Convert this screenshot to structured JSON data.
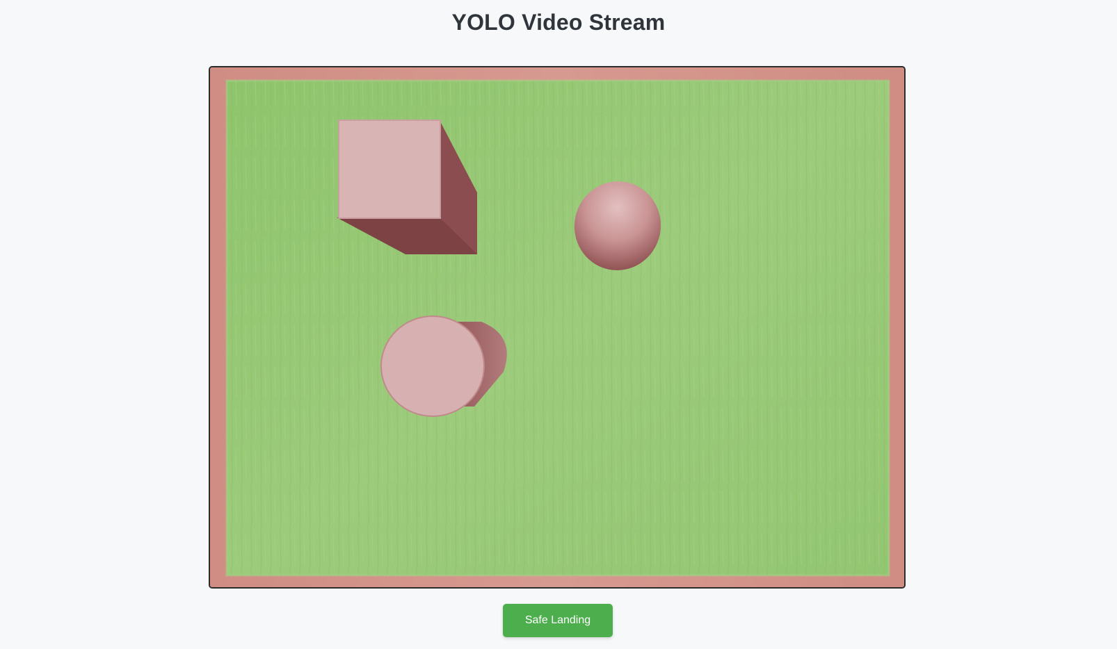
{
  "page": {
    "title": "YOLO Video Stream"
  },
  "video_stream": {
    "objects": [
      "cube",
      "sphere",
      "cylinder"
    ],
    "colors": {
      "border": "#d4958a",
      "grass": "#93c672",
      "object_light": "#d9b2b3",
      "object_dark": "#8c4e50"
    }
  },
  "controls": {
    "safe_landing_label": "Safe Landing",
    "button_color": "#4cae4c"
  }
}
